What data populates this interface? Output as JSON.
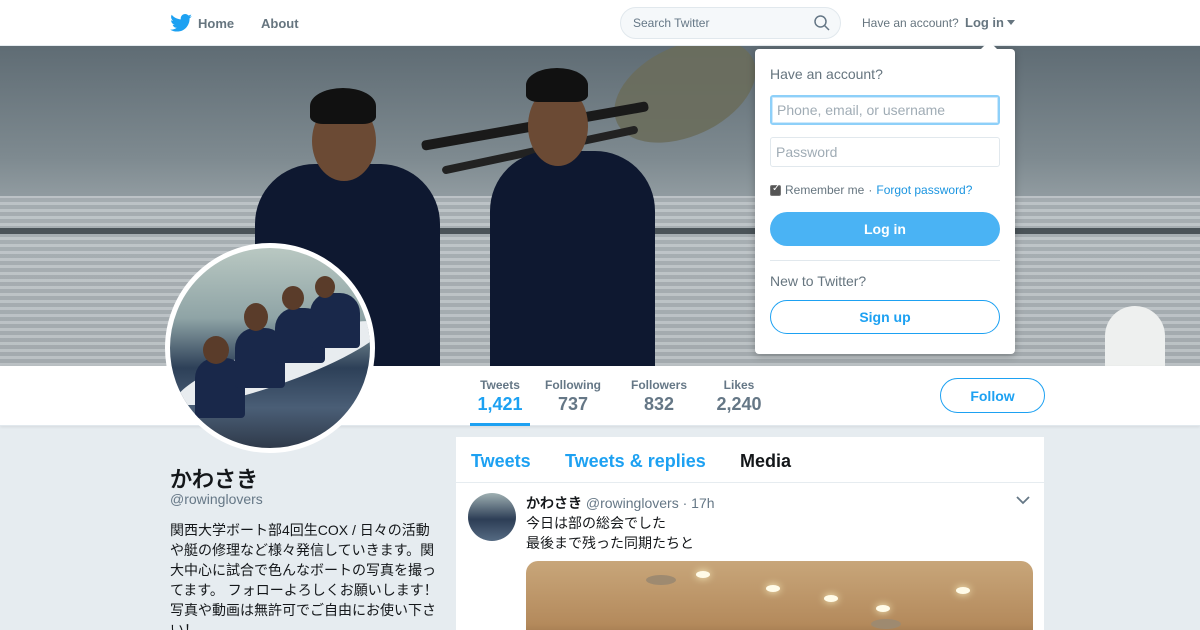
{
  "nav": {
    "home_label": "Home",
    "about_label": "About",
    "search_placeholder": "Search Twitter",
    "account_prompt": "Have an account?",
    "login_label": "Log in"
  },
  "profile": {
    "name": "かわさき",
    "handle": "@rowinglovers",
    "bio": "関西大学ボート部4回生COX / 日々の活動や艇の修理など様々発信していきます。関大中心に試合で色んなボートの写真を撮ってます。 フォローよろしくお願いします！写真や動画は無許可でご自由にお使い下さい！"
  },
  "stats": [
    {
      "label": "Tweets",
      "value": "1,421",
      "active": true
    },
    {
      "label": "Following",
      "value": "737"
    },
    {
      "label": "Followers",
      "value": "832"
    },
    {
      "label": "Likes",
      "value": "2,240"
    }
  ],
  "follow_label": "Follow",
  "tabs": [
    {
      "label": "Tweets"
    },
    {
      "label": "Tweets & replies"
    },
    {
      "label": "Media",
      "current": true
    }
  ],
  "tweet": {
    "name": "かわさき",
    "handle": "@rowinglovers",
    "time": "17h",
    "separator": "·",
    "line1": "今日は部の総会でした",
    "line2": "最後まで残った同期たちと"
  },
  "login_dropdown": {
    "title": "Have an account?",
    "username_placeholder": "Phone, email, or username",
    "password_placeholder": "Password",
    "remember_label": "Remember me",
    "separator": "·",
    "forgot_label": "Forgot password?",
    "login_button": "Log in",
    "new_prompt": "New to Twitter?",
    "signup_button": "Sign up"
  },
  "colors": {
    "accent": "#1da1f2",
    "login_button_bg": "#4ab3f4",
    "background": "#e6ecf0"
  },
  "icons": [
    "twitter-bird-icon",
    "search-icon",
    "chevron-down-icon"
  ]
}
